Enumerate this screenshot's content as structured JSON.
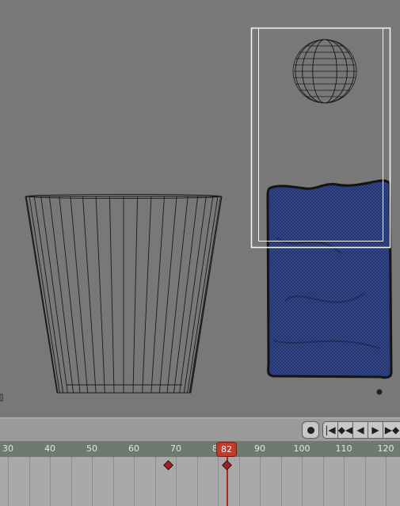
{
  "viewport": {
    "objects": [
      "bucket-wireframe",
      "sphere-wireframe",
      "fluid-mesh",
      "bounding-box"
    ],
    "colors": {
      "background": "#787878",
      "wire": "#1b1b1b",
      "fluid": "#2d3f82",
      "selection": "#f2f2f2"
    }
  },
  "timeline": {
    "current_frame": "82",
    "ticks": [
      "30",
      "40",
      "50",
      "60",
      "70",
      "80",
      "90",
      "100",
      "110",
      "120"
    ],
    "keyframes": [
      68,
      82
    ],
    "buttons": {
      "record": "record",
      "jump_start": "|◀",
      "prev_key": "◆◀",
      "play_reverse": "◀",
      "play": "▶",
      "next_key": "▶◆"
    },
    "colors": {
      "playhead": "#c23a2c",
      "keyframe": "#b01c1c"
    }
  }
}
